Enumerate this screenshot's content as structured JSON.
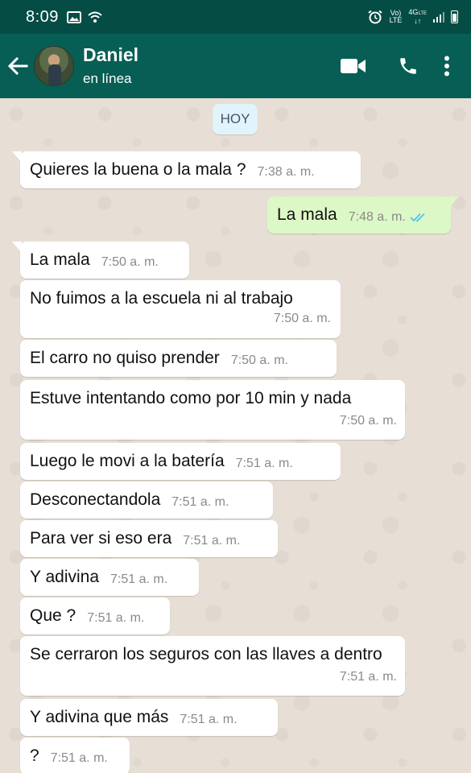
{
  "statusbar": {
    "time": "8:09",
    "network_top": "Vo)",
    "network_bottom": "LTE",
    "gen_top": "4G",
    "gen_sub": "LTE"
  },
  "header": {
    "contact_name": "Daniel",
    "contact_status": "en línea"
  },
  "chat": {
    "date_chip": "HOY",
    "messages": [
      {
        "dir": "in",
        "text": "Quieres la buena o la mala ?",
        "time": "7:38 a. m."
      },
      {
        "dir": "out",
        "text": "La mala",
        "time": "7:48 a. m.",
        "read": true
      },
      {
        "dir": "in",
        "text": "La mala",
        "time": "7:50 a. m."
      },
      {
        "dir": "in",
        "text": "No fuimos a la escuela ni al trabajo",
        "time": "7:50 a. m."
      },
      {
        "dir": "in",
        "text": "El carro no quiso prender",
        "time": "7:50 a. m."
      },
      {
        "dir": "in",
        "text": "Estuve intentando como por 10 min y nada",
        "time": "7:50 a. m."
      },
      {
        "dir": "in",
        "text": "Luego le movi a la batería",
        "time": "7:51 a. m."
      },
      {
        "dir": "in",
        "text": "Desconectandola",
        "time": "7:51 a. m."
      },
      {
        "dir": "in",
        "text": "Para ver si eso era",
        "time": "7:51 a. m."
      },
      {
        "dir": "in",
        "text": "Y adivina",
        "time": "7:51 a. m."
      },
      {
        "dir": "in",
        "text": "Que ?",
        "time": "7:51 a. m."
      },
      {
        "dir": "in",
        "text": "Se cerraron los seguros con las llaves a dentro",
        "time": "7:51 a. m."
      },
      {
        "dir": "in",
        "text": "Y adivina que más",
        "time": "7:51 a. m."
      },
      {
        "dir": "in",
        "text": "?",
        "time": "7:51 a. m."
      }
    ]
  },
  "colors": {
    "statusbar": "#054d44",
    "header": "#075e54",
    "outgoing_bubble": "#dcf8c6",
    "incoming_bubble": "#ffffff",
    "read_ticks": "#4fc3f7"
  },
  "icons": {
    "back": "arrow-left-icon",
    "video": "video-call-icon",
    "call": "phone-icon",
    "menu": "more-vert-icon"
  }
}
